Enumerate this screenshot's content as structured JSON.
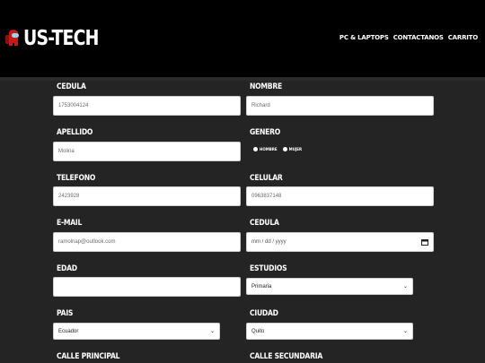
{
  "header": {
    "brand": "US-TECH",
    "nav": [
      "PC & LAPTOPS",
      "CONTACTANOS",
      "CARRITO"
    ]
  },
  "form": {
    "cedula": {
      "label": "CEDULA",
      "value": "1753004124"
    },
    "nombre": {
      "label": "NOMBRE",
      "value": "Richard"
    },
    "apellido": {
      "label": "APELLIDO",
      "value": "Molina"
    },
    "genero": {
      "label": "GENERO",
      "options": [
        "HOMBRE",
        "MUJER"
      ]
    },
    "telefono": {
      "label": "TELEFONO",
      "value": "2423928"
    },
    "celular": {
      "label": "CELULAR",
      "value": "0963837148"
    },
    "email": {
      "label": "E-MAIL",
      "value": "ramolnap@outlook.com"
    },
    "cedula2": {
      "label": "CEDULA",
      "value": "mm / dd / yyyy"
    },
    "edad": {
      "label": "EDAD",
      "value": ""
    },
    "estudios": {
      "label": "ESTUDIOS",
      "value": "Primaria"
    },
    "pais": {
      "label": "PAIS",
      "value": "Ecuador"
    },
    "ciudad": {
      "label": "CIUDAD",
      "value": "Quito"
    },
    "calle_principal": {
      "label": "CALLE PRINCIPAL"
    },
    "calle_secundaria": {
      "label": "CALLE SECUNDARIA"
    }
  },
  "colors": {
    "background": "#242424",
    "header": "#000000",
    "text": "#ffffff"
  }
}
